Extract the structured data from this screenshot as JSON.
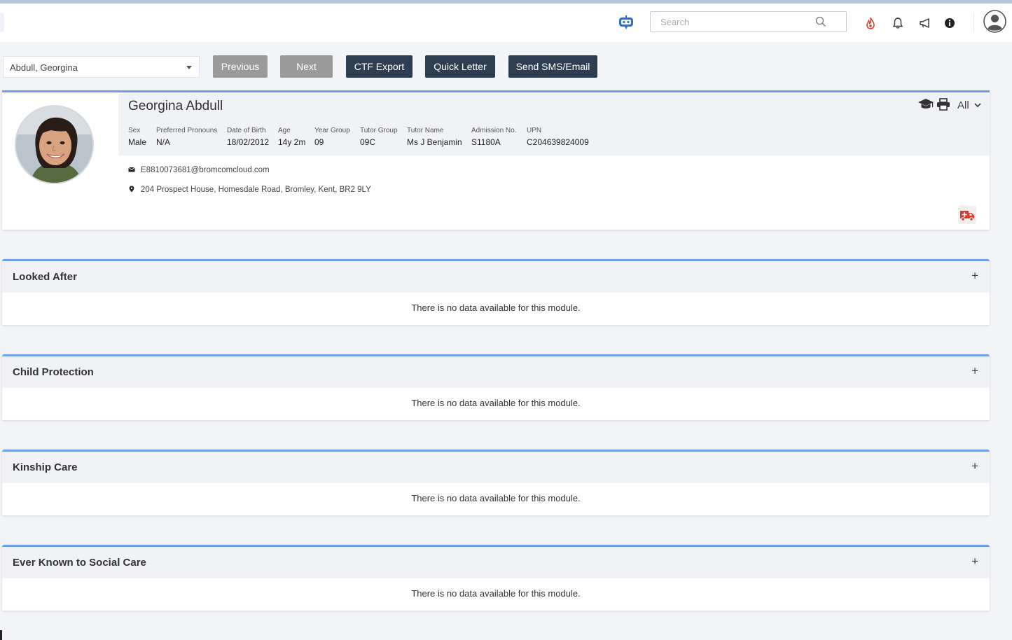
{
  "header": {
    "search_placeholder": "Search",
    "icons": [
      "assistant-bot-icon",
      "search-icon",
      "flame-icon",
      "bell-icon",
      "megaphone-icon",
      "info-icon",
      "user-avatar-icon"
    ]
  },
  "toolbar": {
    "student_selected": "Abdull, Georgina",
    "previous_label": "Previous",
    "next_label": "Next",
    "ctf_export_label": "CTF Export",
    "quick_letter_label": "Quick Letter",
    "send_sms_label": "Send SMS/Email"
  },
  "student": {
    "name": "Georgina Abdull",
    "fields": [
      {
        "label": "Sex",
        "value": "Male"
      },
      {
        "label": "Preferred Pronouns",
        "value": "N/A"
      },
      {
        "label": "Date of Birth",
        "value": "18/02/2012"
      },
      {
        "label": "Age",
        "value": "14y 2m"
      },
      {
        "label": "Year Group",
        "value": "09"
      },
      {
        "label": "Tutor Group",
        "value": "09C"
      },
      {
        "label": "Tutor Name",
        "value": "Ms J Benjamin"
      },
      {
        "label": "Admission No.",
        "value": "S1180A"
      },
      {
        "label": "UPN",
        "value": "C204639824009"
      }
    ],
    "email": "E8810073681@bromcomcloud.com",
    "address": "204 Prospect House, Homesdale Road, Bromley, Kent, BR2 9LY",
    "view_filter": "All"
  },
  "modules": [
    {
      "title": "Looked After",
      "empty_text": "There is no data available for this module.",
      "toggle": "+"
    },
    {
      "title": "Child Protection",
      "empty_text": "There is no data available for this module.",
      "toggle": "+"
    },
    {
      "title": "Kinship Care",
      "empty_text": "There is no data available for this module.",
      "toggle": "+"
    },
    {
      "title": "Ever Known to Social Care",
      "empty_text": "There is no data available for this module.",
      "toggle": "+"
    }
  ],
  "colors": {
    "accent": "#6f9fe8",
    "dark_button": "#2e3e52",
    "grey_button": "#9a9a9a",
    "flame": "#d9432a",
    "ambulance": "#d63b2f"
  }
}
